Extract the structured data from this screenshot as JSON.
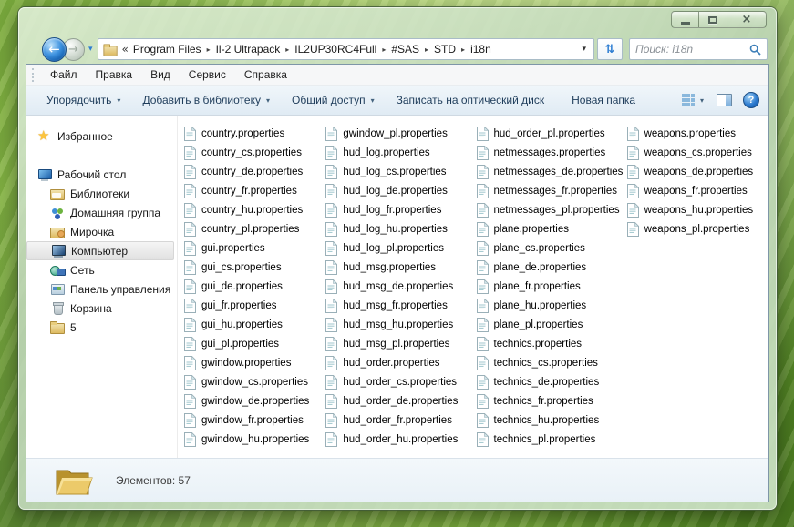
{
  "window": {
    "controls": {
      "close_glyph": "×"
    }
  },
  "navbar": {
    "back_glyph": "←",
    "forward_glyph": "→",
    "history_dropdown_glyph": "▾",
    "refresh_glyph": "⇅",
    "overflow_glyph": "«",
    "address_dropdown_glyph": "▾",
    "crumbs": [
      {
        "label": "Program Files",
        "sep": "▸"
      },
      {
        "label": "Il-2 Ultrapack",
        "sep": "▸"
      },
      {
        "label": "IL2UP30RC4Full",
        "sep": "▸"
      },
      {
        "label": "#SAS",
        "sep": "▸"
      },
      {
        "label": "STD",
        "sep": "▸"
      },
      {
        "label": "i18n",
        "sep": ""
      }
    ],
    "search": {
      "placeholder": "Поиск: i18n"
    }
  },
  "menubar": {
    "items": [
      {
        "label": "Файл"
      },
      {
        "label": "Правка"
      },
      {
        "label": "Вид"
      },
      {
        "label": "Сервис"
      },
      {
        "label": "Справка"
      }
    ]
  },
  "toolbar": {
    "items": [
      {
        "label": "Упорядочить",
        "arrow": "▾"
      },
      {
        "label": "Добавить в библиотеку",
        "arrow": "▾"
      },
      {
        "label": "Общий доступ",
        "arrow": "▾"
      },
      {
        "label": "Записать на оптический диск"
      },
      {
        "label": "Новая папка"
      }
    ],
    "views_arrow": "▾",
    "help_glyph": "?"
  },
  "sidebar": {
    "items": [
      {
        "label": "Избранное",
        "icon": "star",
        "indent": "0",
        "selected": "false"
      },
      {
        "label": "Рабочий стол",
        "icon": "desktop",
        "indent": "0",
        "selected": "false",
        "gap": "true"
      },
      {
        "label": "Библиотеки",
        "icon": "libraries",
        "indent": "1",
        "selected": "false"
      },
      {
        "label": "Домашняя группа",
        "icon": "homegroup",
        "indent": "1",
        "selected": "false"
      },
      {
        "label": "Мирочка",
        "icon": "user",
        "indent": "1",
        "selected": "false"
      },
      {
        "label": "Компьютер",
        "icon": "computer",
        "indent": "1",
        "selected": "true"
      },
      {
        "label": "Сеть",
        "icon": "network",
        "indent": "1",
        "selected": "false"
      },
      {
        "label": "Панель управления",
        "icon": "controlpanel",
        "indent": "1",
        "selected": "false"
      },
      {
        "label": "Корзина",
        "icon": "recycle",
        "indent": "1",
        "selected": "false"
      },
      {
        "label": "5",
        "icon": "folder",
        "indent": "1",
        "selected": "false"
      }
    ]
  },
  "files": {
    "columns": [
      [
        "country.properties",
        "country_cs.properties",
        "country_de.properties",
        "country_fr.properties",
        "country_hu.properties",
        "country_pl.properties",
        "gui.properties",
        "gui_cs.properties",
        "gui_de.properties",
        "gui_fr.properties",
        "gui_hu.properties",
        "gui_pl.properties",
        "gwindow.properties",
        "gwindow_cs.properties",
        "gwindow_de.properties",
        "gwindow_fr.properties",
        "gwindow_hu.properties"
      ],
      [
        "gwindow_pl.properties",
        "hud_log.properties",
        "hud_log_cs.properties",
        "hud_log_de.properties",
        "hud_log_fr.properties",
        "hud_log_hu.properties",
        "hud_log_pl.properties",
        "hud_msg.properties",
        "hud_msg_de.properties",
        "hud_msg_fr.properties",
        "hud_msg_hu.properties",
        "hud_msg_pl.properties",
        "hud_order.properties",
        "hud_order_cs.properties",
        "hud_order_de.properties",
        "hud_order_fr.properties",
        "hud_order_hu.properties"
      ],
      [
        "hud_order_pl.properties",
        "netmessages.properties",
        "netmessages_de.properties",
        "netmessages_fr.properties",
        "netmessages_pl.properties",
        "plane.properties",
        "plane_cs.properties",
        "plane_de.properties",
        "plane_fr.properties",
        "plane_hu.properties",
        "plane_pl.properties",
        "technics.properties",
        "technics_cs.properties",
        "technics_de.properties",
        "technics_fr.properties",
        "technics_hu.properties",
        "technics_pl.properties"
      ],
      [
        "weapons.properties",
        "weapons_cs.properties",
        "weapons_de.properties",
        "weapons_fr.properties",
        "weapons_hu.properties",
        "weapons_pl.properties"
      ]
    ]
  },
  "statusbar": {
    "text": "Элементов: 57"
  }
}
